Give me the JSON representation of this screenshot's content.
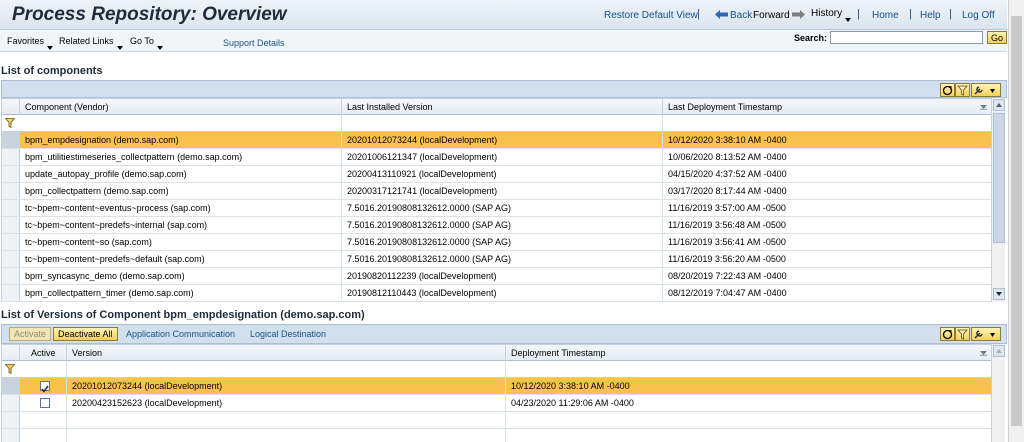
{
  "header": {
    "title": "Process Repository: Overview",
    "restore_default_view": "Restore Default View",
    "back": "Back",
    "forward": "Forward",
    "history": "History",
    "home": "Home",
    "help": "Help",
    "logoff": "Log Off"
  },
  "toolbar": {
    "favorites": "Favorites",
    "related_links": "Related Links",
    "go_to": "Go To",
    "support_details": "Support Details",
    "search_label": "Search:",
    "search_value": "",
    "go": "Go"
  },
  "components": {
    "title": "List of components",
    "columns": [
      "Component (Vendor)",
      "Last Installed Version",
      "Last Deployment Timestamp"
    ],
    "rows": [
      {
        "component": "bpm_empdesignation (demo.sap.com)",
        "version": "20201012073244 (localDevelopment)",
        "timestamp": "10/12/2020 3:38:10 AM -0400",
        "selected": true
      },
      {
        "component": "bpm_utilitiestimeseries_collectpattern (demo.sap.com)",
        "version": "20201006121347 (localDevelopment)",
        "timestamp": "10/06/2020 8:13:52 AM -0400",
        "selected": false
      },
      {
        "component": "update_autopay_profile (demo.sap.com)",
        "version": "20200413110921 (localDevelopment)",
        "timestamp": "04/15/2020 4:37:52 AM -0400",
        "selected": false
      },
      {
        "component": "bpm_collectpattern (demo.sap.com)",
        "version": "20200317121741 (localDevelopment)",
        "timestamp": "03/17/2020 8:17:44 AM -0400",
        "selected": false
      },
      {
        "component": "tc~bpem~content~eventus~process (sap.com)",
        "version": "7.5016.20190808132612.0000 (SAP AG)",
        "timestamp": "11/16/2019 3:57:00 AM -0500",
        "selected": false
      },
      {
        "component": "tc~bpem~content~predefs~internal (sap.com)",
        "version": "7.5016.20190808132612.0000 (SAP AG)",
        "timestamp": "11/16/2019 3:56:48 AM -0500",
        "selected": false
      },
      {
        "component": "tc~bpem~content~so (sap.com)",
        "version": "7.5016.20190808132612.0000 (SAP AG)",
        "timestamp": "11/16/2019 3:56:41 AM -0500",
        "selected": false
      },
      {
        "component": "tc~bpem~content~predefs~default (sap.com)",
        "version": "7.5016.20190808132612.0000 (SAP AG)",
        "timestamp": "11/16/2019 3:56:20 AM -0500",
        "selected": false
      },
      {
        "component": "bpm_syncasync_demo (demo.sap.com)",
        "version": "20190820112239 (localDevelopment)",
        "timestamp": "08/20/2019 7:22:43 AM -0400",
        "selected": false
      },
      {
        "component": "bpm_collectpattern_timer (demo.sap.com)",
        "version": "20190812110443 (localDevelopment)",
        "timestamp": "08/12/2019 7:04:47 AM -0400",
        "selected": false
      }
    ]
  },
  "versions": {
    "title": "List of Versions of Component bpm_empdesignation (demo.sap.com)",
    "activate": "Activate",
    "deactivate_all": "Deactivate All",
    "application_communication": "Application Communication",
    "logical_destination": "Logical Destination",
    "columns": [
      "Active",
      "Version",
      "Deployment Timestamp"
    ],
    "rows": [
      {
        "active": true,
        "version": "20201012073244 (localDevelopment)",
        "timestamp": "10/12/2020 3:38:10 AM -0400",
        "selected": true
      },
      {
        "active": false,
        "version": "20200423152623 (localDevelopment)",
        "timestamp": "04/23/2020 11:29:06 AM -0400",
        "selected": false
      }
    ]
  },
  "colors": {
    "selection": "#fbc14f",
    "link": "#16528c",
    "button": "#f4cf55"
  }
}
